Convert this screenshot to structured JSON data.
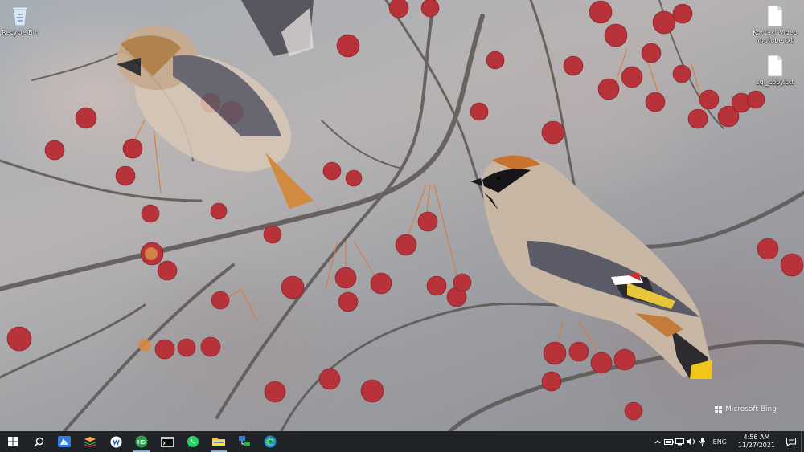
{
  "desktop": {
    "icons": [
      {
        "label": "Recycle Bin",
        "icon": "recycle-bin-icon"
      },
      {
        "label": "Kontakt Video Youtube.txt",
        "icon": "text-file-icon"
      },
      {
        "label": "sql_copy.txt",
        "icon": "text-file-icon"
      }
    ],
    "watermark": "Microsoft Bing"
  },
  "taskbar": {
    "apps": [
      {
        "name": "start-button",
        "icon": "windows-logo-icon"
      },
      {
        "name": "search-button",
        "icon": "search-icon"
      },
      {
        "name": "taskbar-app-azure",
        "icon": "azure-icon"
      },
      {
        "name": "taskbar-app-stack",
        "icon": "stack-icon"
      },
      {
        "name": "taskbar-app-wordpad",
        "icon": "wordpad-icon"
      },
      {
        "name": "taskbar-app-hs",
        "icon": "hs-icon",
        "text": "HS"
      },
      {
        "name": "taskbar-app-terminal",
        "icon": "terminal-icon"
      },
      {
        "name": "taskbar-app-whatsapp",
        "icon": "whatsapp-icon"
      },
      {
        "name": "taskbar-app-file-explorer",
        "icon": "folder-icon"
      },
      {
        "name": "taskbar-app-network",
        "icon": "network-tool-icon"
      },
      {
        "name": "taskbar-app-edge",
        "icon": "edge-icon"
      }
    ],
    "tray": {
      "language": "ENG",
      "time": "4:56 AM",
      "date": "11/27/2021"
    },
    "colors": {
      "background": "#1f2328",
      "active_indicator": "#6fb3ee"
    }
  }
}
